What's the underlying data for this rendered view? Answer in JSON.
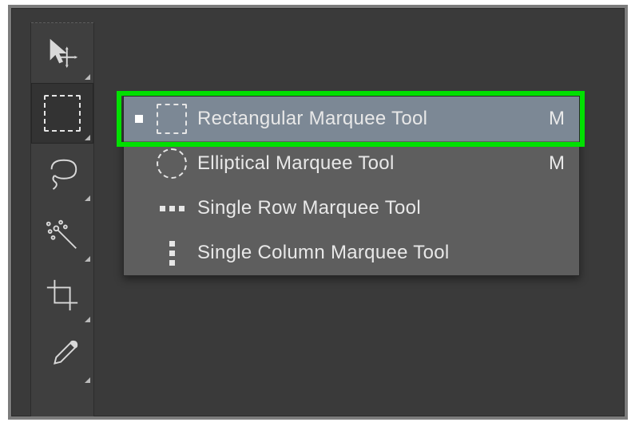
{
  "toolbar": {
    "tools": [
      {
        "name": "move-tool"
      },
      {
        "name": "rectangular-marquee-tool",
        "selected": true
      },
      {
        "name": "lasso-tool"
      },
      {
        "name": "magic-wand-tool"
      },
      {
        "name": "crop-tool"
      },
      {
        "name": "eyedropper-tool"
      }
    ]
  },
  "flyout": {
    "active_index": 0,
    "items": [
      {
        "icon": "rectangular-marquee-icon",
        "label": "Rectangular Marquee Tool",
        "shortcut": "M",
        "selected": true
      },
      {
        "icon": "elliptical-marquee-icon",
        "label": "Elliptical Marquee Tool",
        "shortcut": "M",
        "selected": false
      },
      {
        "icon": "single-row-marquee-icon",
        "label": "Single Row Marquee Tool",
        "shortcut": "",
        "selected": false
      },
      {
        "icon": "single-col-marquee-icon",
        "label": "Single Column Marquee Tool",
        "shortcut": "",
        "selected": false
      }
    ]
  },
  "highlight": {
    "color": "#00e000",
    "target": "flyout.items.0"
  }
}
